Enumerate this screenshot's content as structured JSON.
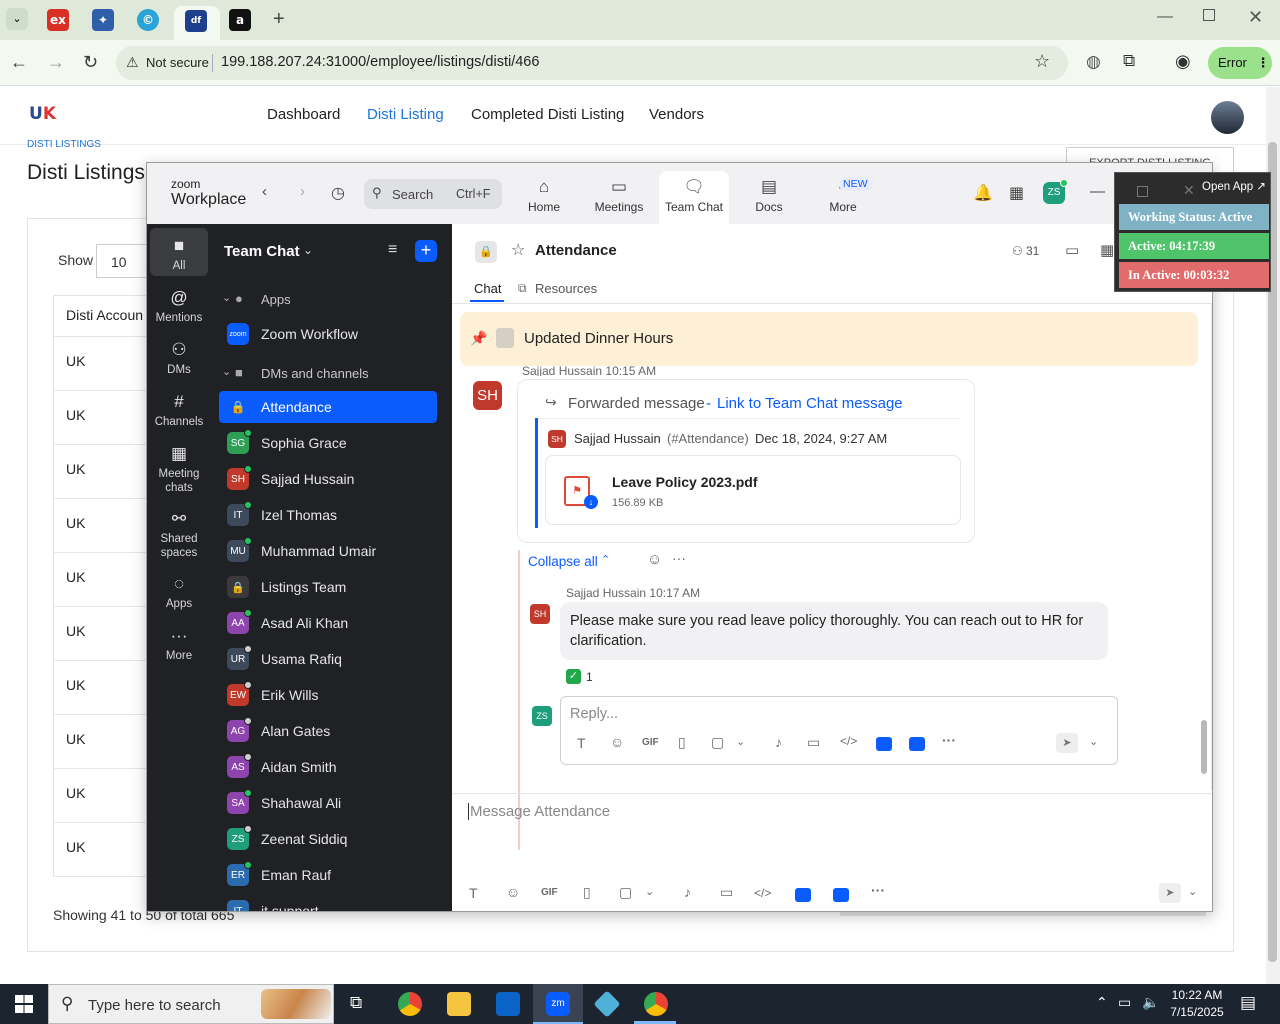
{
  "browser": {
    "tabs": [
      {
        "icon": "ex-icon",
        "color": "#d93025"
      },
      {
        "icon": "bird-icon",
        "color": "#2f5fa8"
      },
      {
        "icon": "copyright-icon",
        "color": "#2aa3d6"
      },
      {
        "icon": "df-icon",
        "color": "#1d3f8c"
      },
      {
        "icon": "amazon-icon",
        "color": "#111111"
      }
    ],
    "security_label": "Not secure",
    "url": "199.188.207.24:31000/employee/listings/disti/466",
    "profile_label": "Error"
  },
  "site": {
    "nav": [
      "Dashboard",
      "Disti Listing",
      "Completed Disti Listing",
      "Vendors"
    ],
    "breadcrumb": "DISTI LISTINGS",
    "page_title": "Disti Listings",
    "export_label": "EXPORT DISTI LISTING",
    "show_label": "Show",
    "show_value": "10",
    "column_header": "Disti Accoun",
    "rows": [
      "UK",
      "UK",
      "UK",
      "UK",
      "UK",
      "UK",
      "UK",
      "UK",
      "UK",
      "UK"
    ],
    "footer": "Showing 41 to 50 of total 665"
  },
  "zoom": {
    "logo_top": "zoom",
    "logo_bottom": "Workplace",
    "search_placeholder": "Search",
    "search_shortcut": "Ctrl+F",
    "top_tabs": [
      {
        "label": "Home",
        "icon": "home-icon"
      },
      {
        "label": "Meetings",
        "icon": "camera-icon"
      },
      {
        "label": "Team Chat",
        "icon": "chat-icon"
      },
      {
        "label": "Docs",
        "icon": "doc-icon"
      },
      {
        "label": "More",
        "icon": "more-icon"
      }
    ],
    "new_badge": "NEW",
    "user_initials": "ZS",
    "rail": [
      {
        "label": "All",
        "icon": "chat-bubble-icon"
      },
      {
        "label": "Mentions",
        "icon": "at-icon"
      },
      {
        "label": "DMs",
        "icon": "people-icon"
      },
      {
        "label": "Channels",
        "icon": "hash-icon"
      },
      {
        "label": "Meeting chats",
        "icon": "calendar-icon"
      },
      {
        "label": "Shared spaces",
        "icon": "share-icon"
      },
      {
        "label": "Apps",
        "icon": "apps-icon"
      },
      {
        "label": "More",
        "icon": "ellipsis-icon"
      }
    ],
    "list_title": "Team Chat",
    "section_apps": "Apps",
    "app_item": "Zoom Workflow",
    "section_dms": "DMs and channels",
    "channels": [
      {
        "name": "Attendance",
        "initials": "",
        "color": "#0b5cff",
        "status": ""
      },
      {
        "name": "Sophia Grace",
        "initials": "SG",
        "color": "#2e9e55",
        "status": "#22c55e"
      },
      {
        "name": "Sajjad Hussain",
        "initials": "SH",
        "color": "#c0392b",
        "status": "#22c55e"
      },
      {
        "name": "Izel Thomas",
        "initials": "IT",
        "color": "#3c4a5c",
        "status": "#22c55e"
      },
      {
        "name": "Muhammad Umair",
        "initials": "MU",
        "color": "#3c4a5c",
        "status": "#22c55e"
      },
      {
        "name": "Listings Team",
        "initials": "",
        "color": "#3a3a3a",
        "status": ""
      },
      {
        "name": "Asad Ali Khan",
        "initials": "AA",
        "color": "#8e44ad",
        "status": "#22c55e"
      },
      {
        "name": "Usama Rafiq",
        "initials": "UR",
        "color": "#3c4a5c",
        "status": "#cfcfcf"
      },
      {
        "name": "Erik Wills",
        "initials": "EW",
        "color": "#c0392b",
        "status": "#cfcfcf"
      },
      {
        "name": "Alan Gates",
        "initials": "AG",
        "color": "#8e44ad",
        "status": "#cfcfcf"
      },
      {
        "name": "Aidan Smith",
        "initials": "AS",
        "color": "#8e44ad",
        "status": "#cfcfcf"
      },
      {
        "name": "Shahawal Ali",
        "initials": "SA",
        "color": "#8e44ad",
        "status": "#22c55e"
      },
      {
        "name": "Zeenat Siddiq",
        "initials": "ZS",
        "color": "#1e9e7a",
        "status": "#cfcfcf"
      },
      {
        "name": "Eman Rauf",
        "initials": "ER",
        "color": "#2b6cb0",
        "status": "#22c55e"
      },
      {
        "name": "it support",
        "initials": "IT",
        "color": "#2b6cb0",
        "status": ""
      }
    ],
    "channel_title": "Attendance",
    "member_count": "31",
    "tab_chat": "Chat",
    "tab_resources": "Resources",
    "pinned": "Updated Dinner Hours",
    "msg1_sender": "Sajjad Hussain",
    "msg1_time": "10:15 AM",
    "forwarded_label": "Forwarded message",
    "forwarded_sep": "-",
    "forwarded_link": "Link to Team Chat message",
    "orig_sender": "Sajjad Hussain",
    "orig_channel": "(#Attendance)",
    "orig_date": "Dec 18, 2024, 9:27 AM",
    "file_name": "Leave Policy 2023.pdf",
    "file_size": "156.89 KB",
    "collapse_label": "Collapse all",
    "reply_sender": "Sajjad Hussain",
    "reply_time": "10:17 AM",
    "reply_text": "Please make sure you read leave policy thoroughly. You can reach out to HR for clarification.",
    "reaction_count": "1",
    "reply_placeholder": "Reply...",
    "composer_placeholder": "Message Attendance",
    "gif_label": "GIF"
  },
  "status_widget": {
    "open_app": "Open App",
    "working": "Working Status: Active",
    "active": "Active: 04:17:39",
    "inactive": "In Active: 00:03:32",
    "colors": {
      "working": "#7fb2c4",
      "active": "#4fc46a",
      "inactive": "#e26b6b"
    }
  },
  "taskbar": {
    "search_placeholder": "Type here to search",
    "time": "10:22 AM",
    "date": "7/15/2025"
  }
}
